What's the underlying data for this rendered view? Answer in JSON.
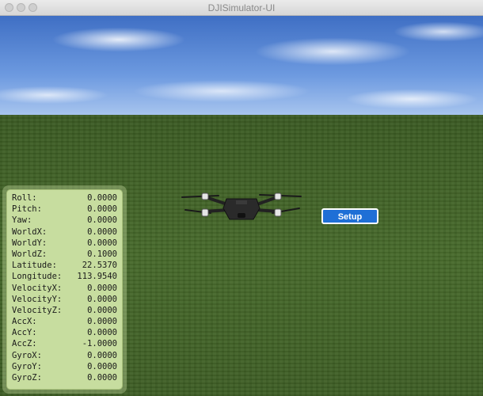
{
  "window": {
    "title": "DJISimulator-UI"
  },
  "setup_button": {
    "label": "Setup"
  },
  "telemetry": [
    {
      "label": "Roll:",
      "value": "0.0000"
    },
    {
      "label": "Pitch:",
      "value": "0.0000"
    },
    {
      "label": "Yaw:",
      "value": "0.0000"
    },
    {
      "label": "WorldX:",
      "value": "0.0000"
    },
    {
      "label": "WorldY:",
      "value": "0.0000"
    },
    {
      "label": "WorldZ:",
      "value": "0.1000"
    },
    {
      "label": "Latitude:",
      "value": "22.5370"
    },
    {
      "label": "Longitude:",
      "value": "113.9540"
    },
    {
      "label": "VelocityX:",
      "value": "0.0000"
    },
    {
      "label": "VelocityY:",
      "value": "0.0000"
    },
    {
      "label": "VelocityZ:",
      "value": "0.0000"
    },
    {
      "label": "AccX:",
      "value": "0.0000"
    },
    {
      "label": "AccY:",
      "value": "0.0000"
    },
    {
      "label": "AccZ:",
      "value": "-1.0000"
    },
    {
      "label": "GyroX:",
      "value": "0.0000"
    },
    {
      "label": "GyroY:",
      "value": "0.0000"
    },
    {
      "label": "GyroZ:",
      "value": "0.0000"
    }
  ],
  "colors": {
    "accent": "#1f6fd6",
    "panel": "#c7dd9f",
    "ground": "#3f5f25",
    "sky": "#5b87d6"
  }
}
